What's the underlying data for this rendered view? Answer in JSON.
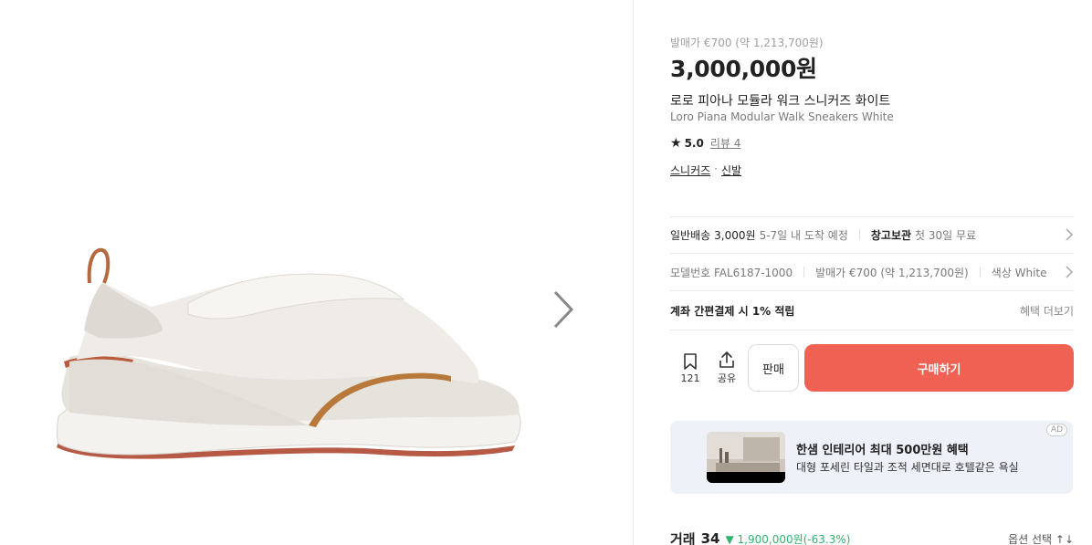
{
  "gallery": {
    "image_alt": "shoe",
    "next_icon": "chevron-right-icon"
  },
  "product": {
    "release_price": "발매가 €700 (약 1,213,700원)",
    "price": "3,000,000원",
    "name_ko": "로로 피아나 모듈라 워크 스니커즈 화이트",
    "name_en": "Loro Piana Modular Walk Sneakers White",
    "rating": "5.0",
    "reviews": "리뷰 4",
    "category1": "스니커즈",
    "category_sep": "·",
    "category2": "신발"
  },
  "delivery": {
    "label1": "일반배송",
    "value1": "3,000원",
    "note1": "5-7일 내 도착 예정",
    "label2": "창고보관",
    "value2": "첫 30일 무료"
  },
  "specs": {
    "model": "모델번호 FAL6187-1000",
    "release": "발매가 €700 (약 1,213,700원)",
    "color": "색상 White"
  },
  "benefit": {
    "title": "계좌 간편결제 시 1% 적립",
    "more": "혜택 더보기"
  },
  "actions": {
    "bookmark_count": "121",
    "share_label": "공유",
    "sell_label": "판매",
    "buy_label": "구매하기"
  },
  "ad": {
    "title": "한샘 인테리어 최대 500만원 혜택",
    "subtitle": "대형 포세린 타일과 조적 세면대로 호텔같은 욕실",
    "badge": "AD"
  },
  "trades": {
    "title": "거래",
    "count": "34",
    "change": "▼ 1,900,000원(-63.3%)",
    "option": "옵션 선택 ↑↓"
  },
  "colors": {
    "buy": "#ef6253",
    "down": "#31b46e",
    "ad_bg": "#eef1f7"
  }
}
